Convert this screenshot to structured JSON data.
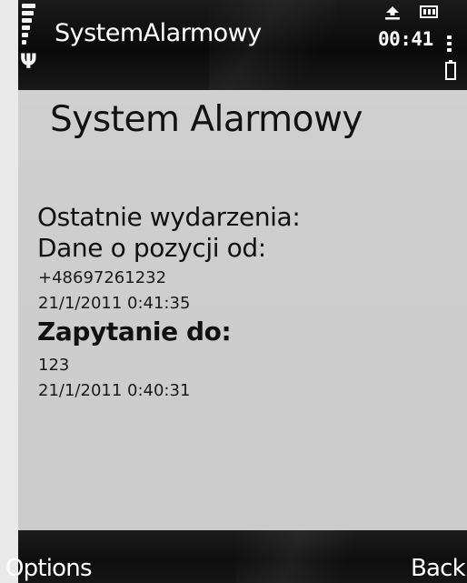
{
  "status_bar": {
    "app_title": "SystemAlarmowy",
    "clock": "00:41",
    "icons": [
      "signal-strength-icon",
      "antenna-icon",
      "upload-icon",
      "battery-indicator-icon",
      "options-dots-icon",
      "battery-icon"
    ]
  },
  "main": {
    "title": "System Alarmowy",
    "recent_events_label": "Ostatnie wydarzenia:",
    "position_data_label": "Dane o pozycji od:",
    "position_sender": "+48697261232",
    "position_timestamp": "21/1/2011 0:41:35",
    "query_label": "Zapytanie do:",
    "query_recipient": "123",
    "query_timestamp": "21/1/2011 0:40:31"
  },
  "softkeys": {
    "left_label": "Options",
    "right_label": "Back"
  }
}
